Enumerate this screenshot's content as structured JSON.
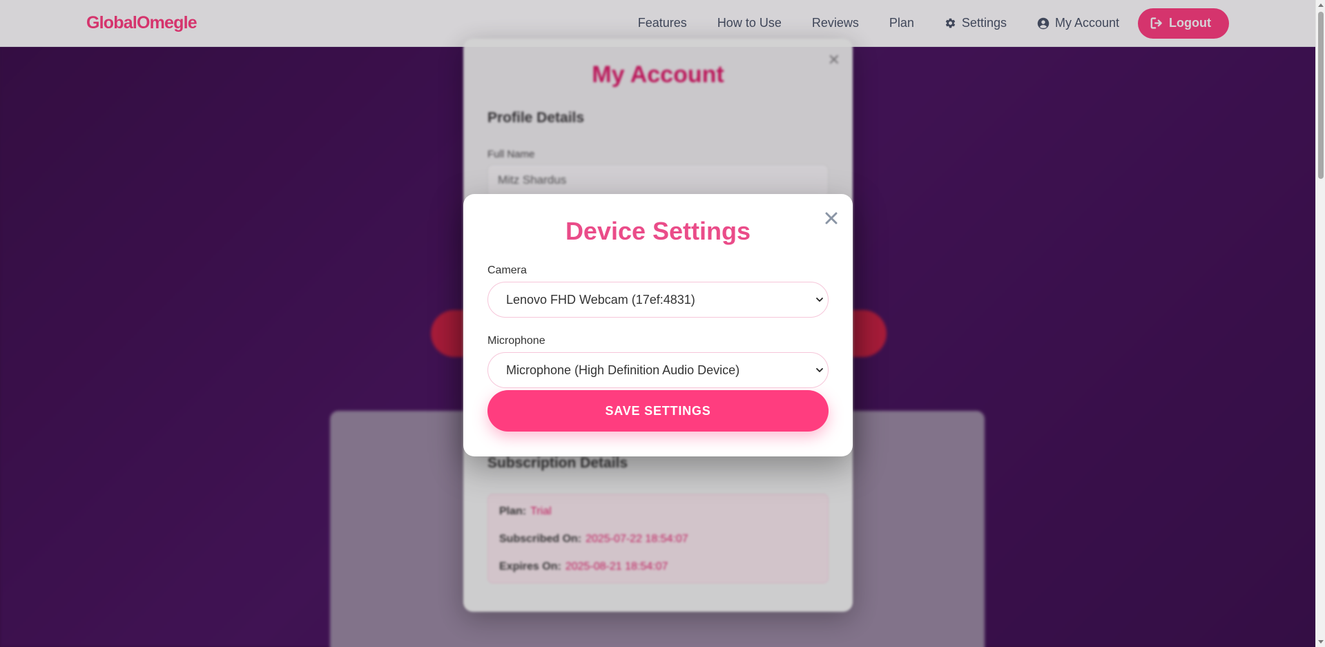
{
  "nav": {
    "logo": "GlobalOmegle",
    "links": [
      "Features",
      "How to Use",
      "Reviews",
      "Plan"
    ],
    "settings_label": "Settings",
    "account_label": "My Account",
    "logout_label": "Logout"
  },
  "account_modal": {
    "title": "My Account",
    "profile_heading": "Profile Details",
    "full_name_label": "Full Name",
    "full_name_value": "Mitz Shardus",
    "subscription_heading": "Subscription Details",
    "plan_label": "Plan:",
    "plan_value": "Trial",
    "subscribed_label": "Subscribed On:",
    "subscribed_value": "2025-07-22 18:54:07",
    "expires_label": "Expires On:",
    "expires_value": "2025-08-21 18:54:07"
  },
  "device_modal": {
    "title": "Device Settings",
    "camera_label": "Camera",
    "camera_value": "Lenovo FHD Webcam (17ef:4831)",
    "microphone_label": "Microphone",
    "microphone_value": "Microphone (High Definition Audio Device)",
    "save_label": "SAVE SETTINGS"
  },
  "colors": {
    "accent": "#ff3d7f",
    "title_pink": "#ea4c89",
    "background": "#3a0e4a"
  }
}
